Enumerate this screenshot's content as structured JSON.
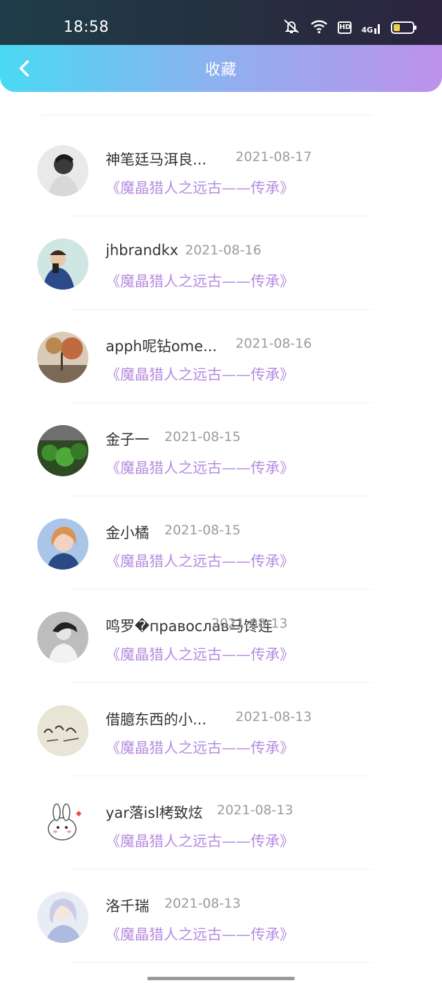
{
  "status_bar": {
    "time": "18:58",
    "hd_label": "HD",
    "network_label": "4G",
    "battery_level": 0.35
  },
  "header": {
    "title": "收藏",
    "back_icon": "chevron-left-icon"
  },
  "items": [
    {
      "name": "神笔廷马洱良...",
      "date": "2021-08-17",
      "book": "《魔晶猎人之远古——传承》"
    },
    {
      "name": "jhbrandkx",
      "date": "2021-08-16",
      "book": "《魔晶猎人之远古——传承》"
    },
    {
      "name": "apph呢钻ome...",
      "date": "2021-08-16",
      "book": "《魔晶猎人之远古——传承》"
    },
    {
      "name": "金子一",
      "date": "2021-08-15",
      "book": "《魔晶猎人之远古——传承》"
    },
    {
      "name": "金小橘",
      "date": "2021-08-15",
      "book": "《魔晶猎人之远古——传承》"
    },
    {
      "name": "鸣罗�православ马馋连",
      "date": "2021-08-13",
      "book": "《魔晶猎人之远古——传承》"
    },
    {
      "name": "借臆东西的小...",
      "date": "2021-08-13",
      "book": "《魔晶猎人之远古——传承》"
    },
    {
      "name": "yar落isl栲致炫",
      "date": "2021-08-13",
      "book": "《魔晶猎人之远古——传承》"
    },
    {
      "name": "洛千瑞",
      "date": "2021-08-13",
      "book": "《魔晶猎人之远古——传承》"
    }
  ],
  "colors": {
    "header_gradient_start": "#4ad9f2",
    "header_gradient_end": "#bd92ea",
    "book_title": "#b68be0",
    "date": "#9b9b9b",
    "name": "#333333"
  }
}
